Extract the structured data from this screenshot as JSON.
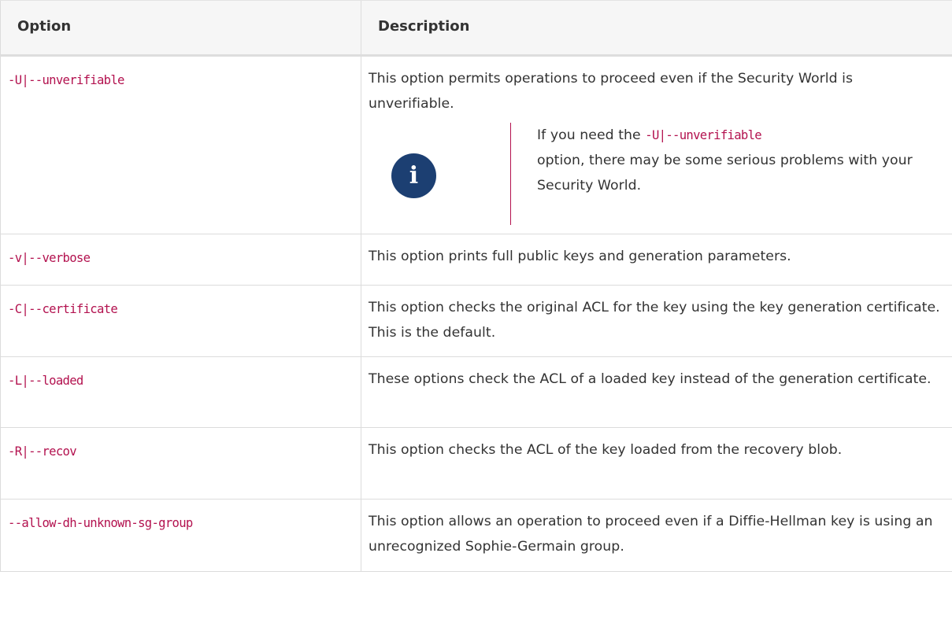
{
  "table": {
    "headers": [
      "Option",
      "Description"
    ],
    "rows": [
      {
        "option": "-U|--unverifiable",
        "description": "This option permits operations to proceed even if the Security World is unverifiable.",
        "note": {
          "icon": "info-icon",
          "prefix": "If you need the ",
          "code": "-U|--unverifiable",
          "suffix": " option, there may be some serious problems with your Security World."
        }
      },
      {
        "option": "-v|--verbose",
        "description": "This option prints full public keys and generation parameters."
      },
      {
        "option": "-C|--certificate",
        "description": "This option checks the original ACL for the key using the key generation certificate. This is the default."
      },
      {
        "option": "-L|--loaded",
        "description": "These options check the ACL of a loaded key instead of the generation certificate."
      },
      {
        "option": "-R|--recov",
        "description": "This option checks the ACL of the key loaded from the recovery blob."
      },
      {
        "option": "--allow-dh-unknown-sg-group",
        "description": "This option allows an operation to proceed even if a Diffie-Hellman key is using an unrecognized Sophie-Germain group."
      }
    ]
  },
  "colors": {
    "code": "#b3124f",
    "info_icon_bg": "#1c3f72",
    "header_bg": "#f6f6f6",
    "text": "#333333",
    "border": "#dcdcdc"
  }
}
